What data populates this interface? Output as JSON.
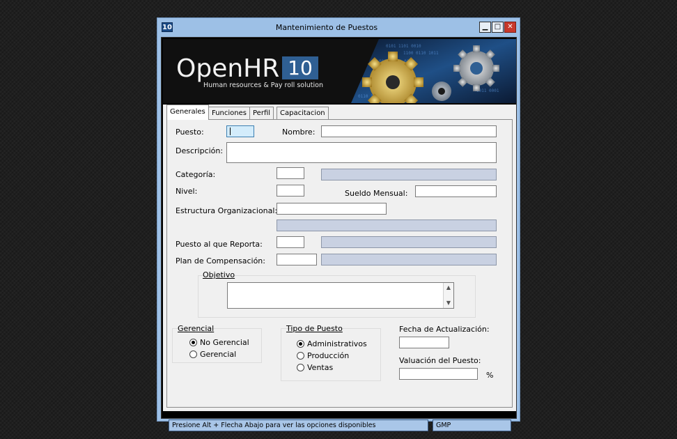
{
  "window": {
    "title": "Mantenimiento de Puestos",
    "icon_label": "10",
    "minimize_glyph": "▁",
    "maximize_glyph": "□",
    "close_glyph": "✕"
  },
  "banner": {
    "logo_text": "OpenHR",
    "logo_badge": "10",
    "tagline": "Human resources & Pay roll solution"
  },
  "tabs": [
    {
      "label": "Generales",
      "active": true
    },
    {
      "label": "Funciones",
      "active": false
    },
    {
      "label": "Perfil",
      "active": false
    },
    {
      "label": "Capacitacion",
      "active": false
    }
  ],
  "form": {
    "puesto_label": "Puesto:",
    "puesto_value": "",
    "nombre_label": "Nombre:",
    "nombre_value": "",
    "descripcion_label": "Descripción:",
    "descripcion_value": "",
    "categoria_label": "Categoría:",
    "nivel_label": "Nivel:",
    "sueldo_label": "Sueldo Mensual:",
    "estructura_label": "Estructura Organizacional:",
    "reporta_label": "Puesto al que Reporta:",
    "plan_label": "Plan de Compensación:",
    "objetivo_label": "Objetivo",
    "objetivo_value": ""
  },
  "gerencial": {
    "title": "Gerencial",
    "options": [
      {
        "label": "No Gerencial",
        "checked": true
      },
      {
        "label": "Gerencial",
        "checked": false
      }
    ]
  },
  "tipo_puesto": {
    "title": "Tipo de Puesto",
    "options": [
      {
        "label": "Administrativos",
        "checked": true
      },
      {
        "label": "Producción",
        "checked": false
      },
      {
        "label": "Ventas",
        "checked": false
      }
    ]
  },
  "fecha_actualizacion_label": "Fecha de Actualización:",
  "valuacion_label": "Valuación del Puesto:",
  "valuacion_unit": "%",
  "status": {
    "message": "Presione Alt + Flecha Abajo para ver las opciones disponibles",
    "code": "GMP"
  }
}
